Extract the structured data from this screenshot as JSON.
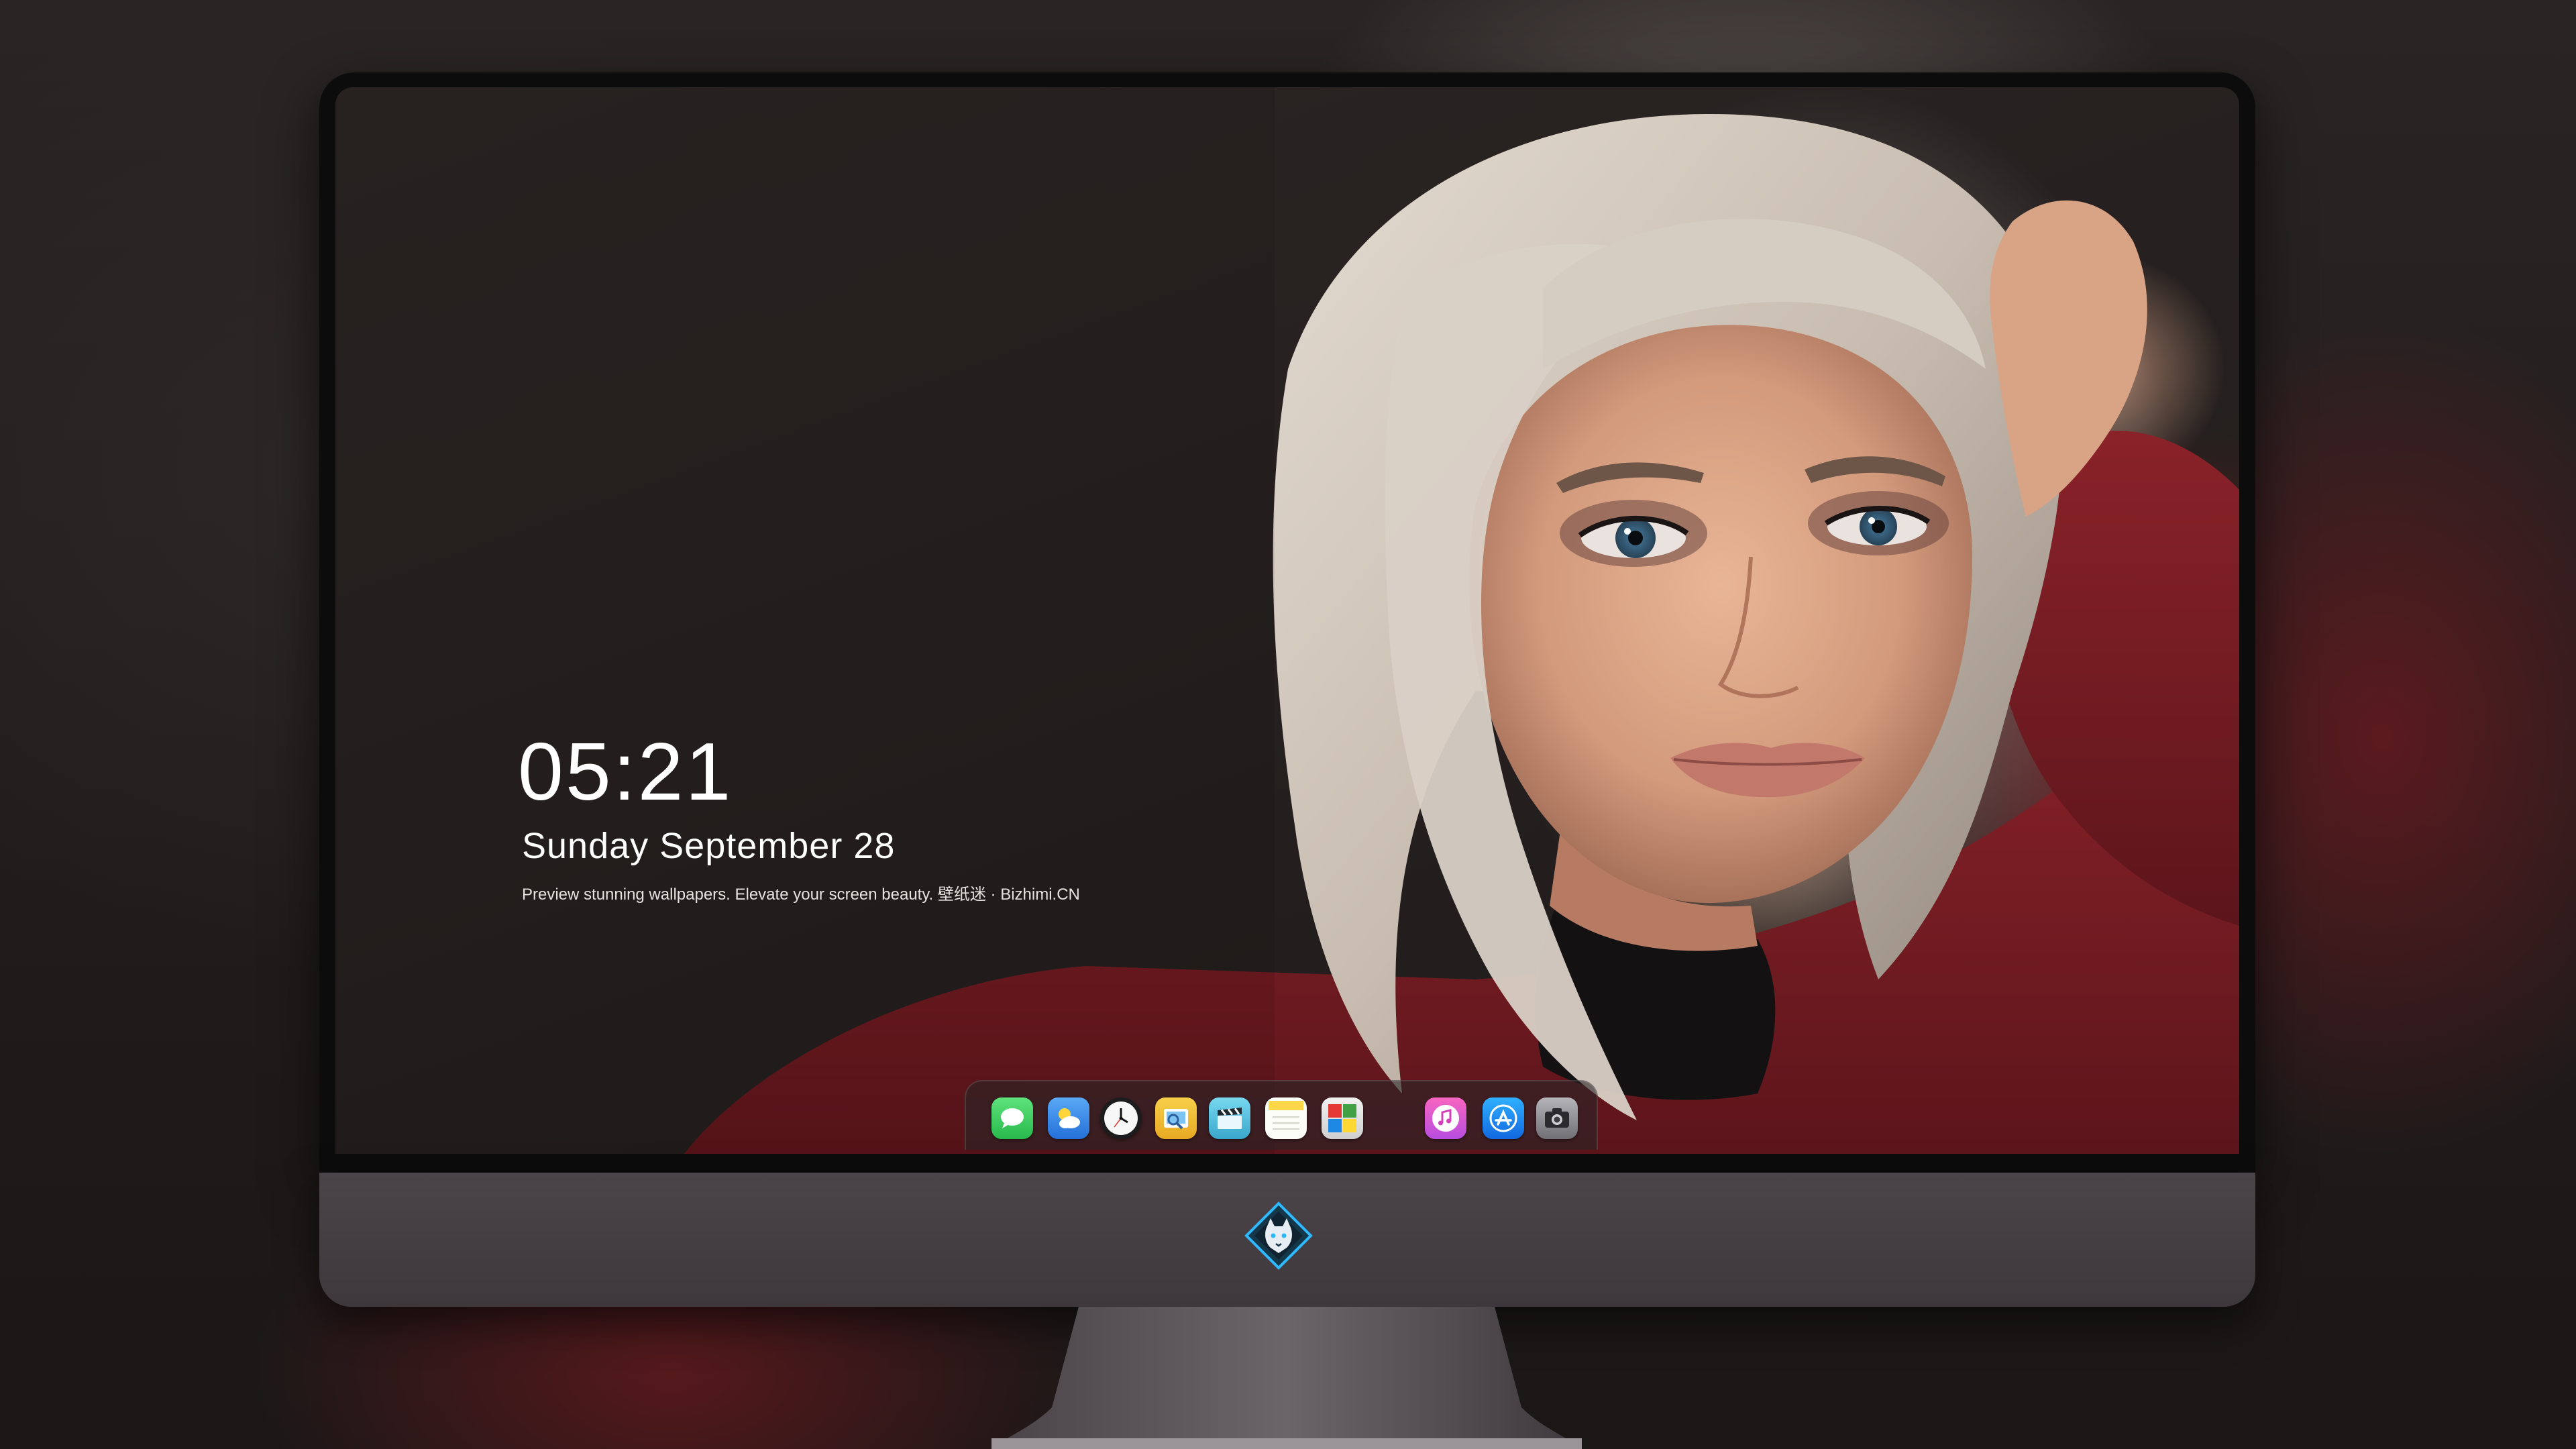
{
  "lock_widget": {
    "time": "05:21",
    "date": "Sunday September  28",
    "tagline": "Preview stunning wallpapers. Elevate your screen beauty. 壁纸迷 · Bizhimi.CN"
  },
  "dock": {
    "apps": [
      {
        "name": "messages-icon",
        "color": "#34c759"
      },
      {
        "name": "weather-icon",
        "color": "#2f8cf0"
      },
      {
        "name": "clock-icon",
        "color": "#1c1c1e"
      },
      {
        "name": "preview-icon",
        "color": "#f1c02c"
      },
      {
        "name": "final-cut-icon",
        "color": "#4fc3e3"
      },
      {
        "name": "notes-icon",
        "color": "#ffd54a"
      },
      {
        "name": "photo-booth-icon",
        "color": "#e4e4e4"
      },
      {
        "name": "itunes-icon",
        "color": "#e24aa4"
      },
      {
        "name": "app-store-icon",
        "color": "#1f8cf3"
      },
      {
        "name": "camera-icon",
        "color": "#8a8a8e"
      }
    ]
  },
  "monitor": {
    "logo": "diamond-wolf-logo-icon",
    "accent": "#2fb9ff"
  }
}
